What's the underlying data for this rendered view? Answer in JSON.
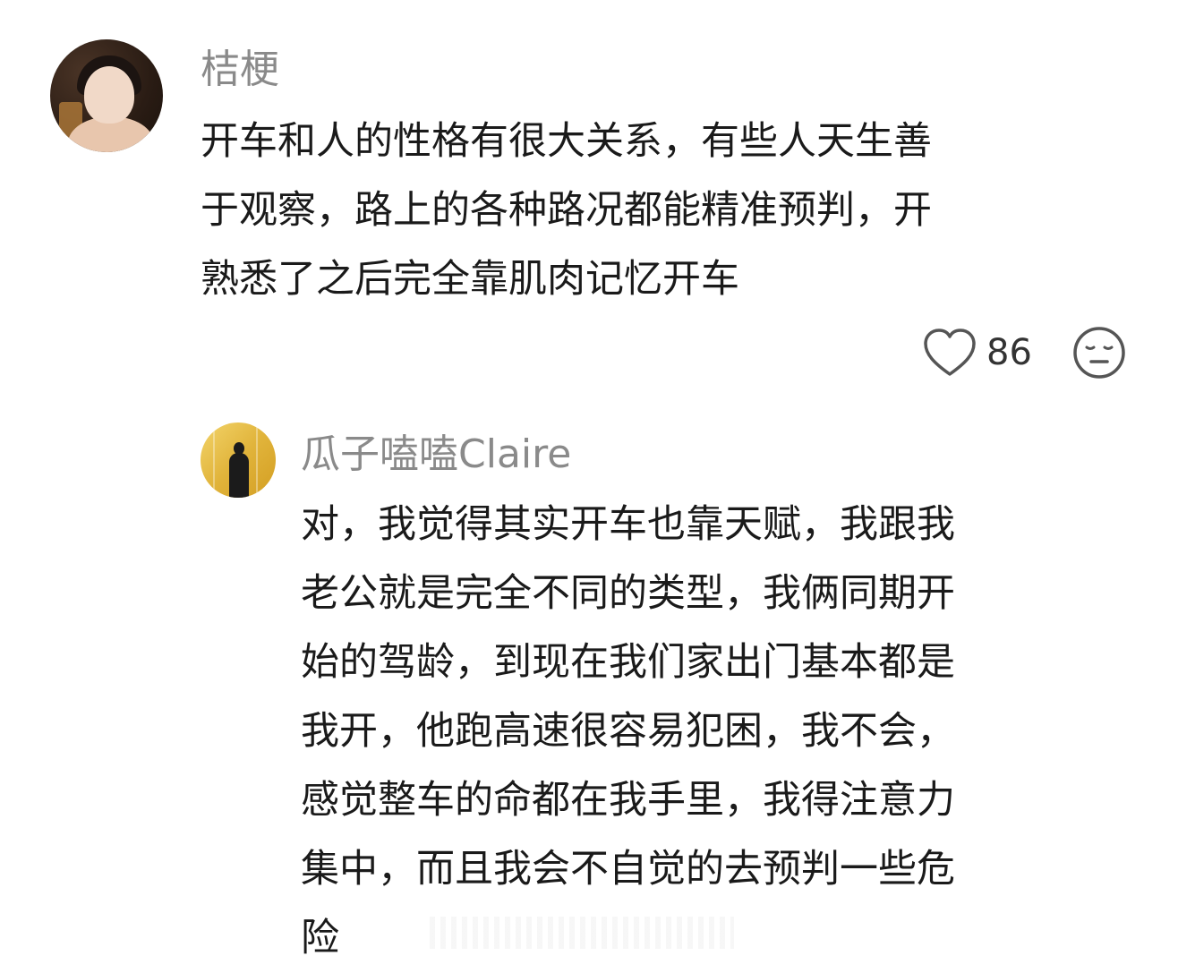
{
  "comments": [
    {
      "username": "桔梗",
      "avatar": "avatar-photo-woman",
      "lines": [
        "开车和人的性格有很大关系，有些人天生善",
        "于观察，路上的各种路况都能精准预判，开",
        "熟悉了之后完全靠肌肉记忆开车"
      ],
      "like_count": "86",
      "icons": {
        "like": "heart-outline-icon",
        "reaction": "expressionless-face-icon"
      }
    },
    {
      "username": "瓜子嗑嗑Claire",
      "avatar": "avatar-silhouette-gold",
      "lines": [
        "对，我觉得其实开车也靠天赋，我跟我",
        "老公就是完全不同的类型，我俩同期开",
        "始的驾龄，到现在我们家出门基本都是",
        "我开，他跑高速很容易犯困，我不会，",
        "感觉整车的命都在我手里，我得注意力",
        "集中，而且我会不自觉的去预判一些危",
        "险"
      ]
    }
  ],
  "colors": {
    "background": "#ffffff",
    "username": "#8a8a8a",
    "text": "#1a1a1a",
    "icon": "#555555"
  }
}
